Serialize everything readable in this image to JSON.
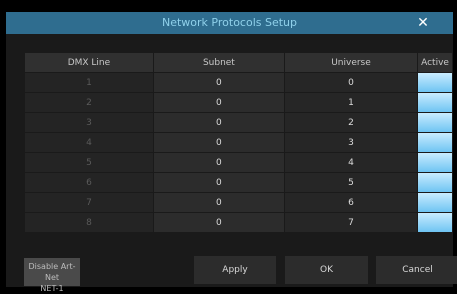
{
  "window": {
    "title": "Network Protocols Setup",
    "close_glyph": "✕",
    "close_icon": "close-icon"
  },
  "table": {
    "headers": [
      "DMX Line",
      "Subnet",
      "Universe",
      "Active"
    ],
    "rows": [
      {
        "dmx": "1",
        "subnet": "0",
        "universe": "0",
        "active": true
      },
      {
        "dmx": "2",
        "subnet": "0",
        "universe": "1",
        "active": true
      },
      {
        "dmx": "3",
        "subnet": "0",
        "universe": "2",
        "active": true
      },
      {
        "dmx": "4",
        "subnet": "0",
        "universe": "3",
        "active": true
      },
      {
        "dmx": "5",
        "subnet": "0",
        "universe": "4",
        "active": true
      },
      {
        "dmx": "6",
        "subnet": "0",
        "universe": "5",
        "active": true
      },
      {
        "dmx": "7",
        "subnet": "0",
        "universe": "6",
        "active": true
      },
      {
        "dmx": "8",
        "subnet": "0",
        "universe": "7",
        "active": true
      }
    ]
  },
  "buttons": {
    "disable_line1": "Disable Art-Net",
    "disable_line2": "NET-1",
    "apply": "Apply",
    "ok": "OK",
    "cancel": "Cancel"
  },
  "colors": {
    "titlebar": "#2f6d8f",
    "active_fill": "#6fc4f2"
  }
}
